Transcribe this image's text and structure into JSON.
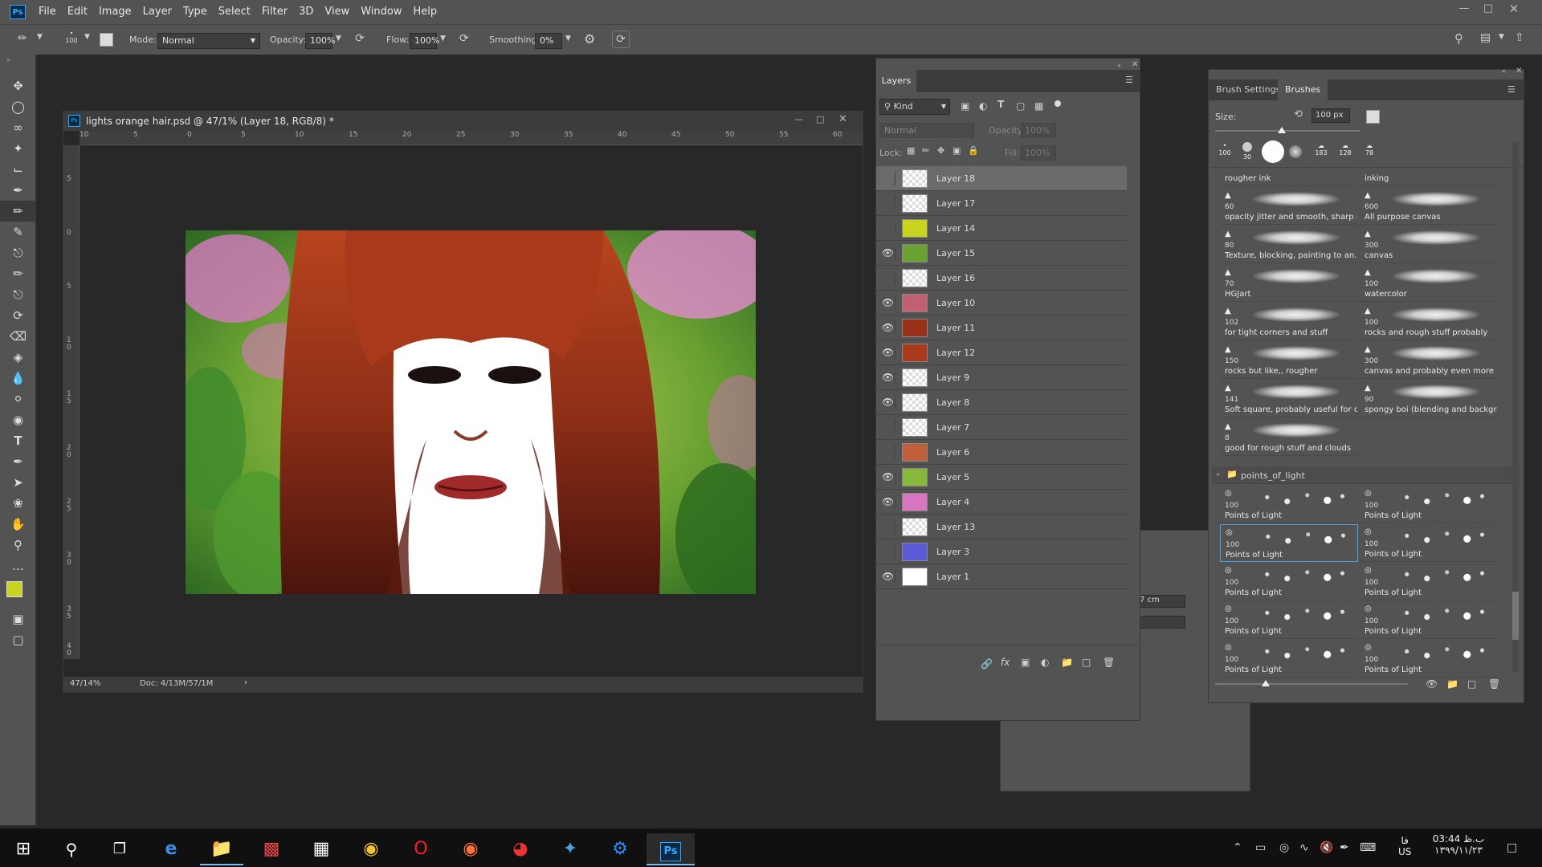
{
  "app": {
    "logo": "Ps"
  },
  "menu": [
    "File",
    "Edit",
    "Image",
    "Layer",
    "Type",
    "Select",
    "Filter",
    "3D",
    "View",
    "Window",
    "Help"
  ],
  "options": {
    "brush_size": "100",
    "mode_label": "Mode:",
    "mode_value": "Normal",
    "opacity_label": "Opacity:",
    "opacity_value": "100%",
    "flow_label": "Flow:",
    "flow_value": "100%",
    "smoothing_label": "Smoothing:",
    "smoothing_value": "0%"
  },
  "document": {
    "title": "lights orange hair.psd @ 47/1% (Layer 18, RGB/8) *",
    "zoom": "47/14%",
    "doc_info": "Doc: 4/13M/57/1M",
    "ruler_h": [
      "10",
      "5",
      "0",
      "5",
      "10",
      "15",
      "20",
      "25",
      "30",
      "35",
      "40",
      "45",
      "50",
      "55",
      "60"
    ],
    "ruler_v": [
      "5",
      "0",
      "5",
      "1\n0",
      "1\n5",
      "2\n0",
      "2\n5",
      "3\n0",
      "3\n5",
      "4\n0"
    ]
  },
  "layers_panel": {
    "tab": "Layers",
    "kind_label": "Kind",
    "blend_mode": "Normal",
    "opacity_label": "Opacity:",
    "opacity_value": "100%",
    "lock_label": "Lock:",
    "fill_label": "Fill:",
    "fill_value": "100%",
    "layers": [
      {
        "name": "Layer 18",
        "visible": false,
        "selected": true
      },
      {
        "name": "Layer 17",
        "visible": false
      },
      {
        "name": "Layer 14",
        "visible": false
      },
      {
        "name": "Layer 15",
        "visible": true
      },
      {
        "name": "Layer 16",
        "visible": false
      },
      {
        "name": "Layer 10",
        "visible": true
      },
      {
        "name": "Layer 11",
        "visible": true
      },
      {
        "name": "Layer 12",
        "visible": true
      },
      {
        "name": "Layer 9",
        "visible": true
      },
      {
        "name": "Layer 8",
        "visible": true
      },
      {
        "name": "Layer 7",
        "visible": false
      },
      {
        "name": "Layer 6",
        "visible": false
      },
      {
        "name": "Layer 5",
        "visible": true
      },
      {
        "name": "Layer 4",
        "visible": true
      },
      {
        "name": "Layer 13",
        "visible": false
      },
      {
        "name": "Layer 3",
        "visible": false
      },
      {
        "name": "Layer 1",
        "visible": true
      }
    ]
  },
  "brushes_panel": {
    "tabs": [
      "Brush Settings",
      "Brushes"
    ],
    "size_label": "Size:",
    "size_value": "100 px",
    "preset_sizes": [
      "100",
      "30",
      "",
      "",
      "183",
      "128",
      "78"
    ],
    "brushes": [
      {
        "num": "",
        "name": "rougher ink"
      },
      {
        "num": "",
        "name": "inking"
      },
      {
        "num": "60",
        "name": "opacity jitter and smooth, sharp i..."
      },
      {
        "num": "600",
        "name": "All purpose canvas"
      },
      {
        "num": "80",
        "name": "Texture, blocking, painting to an..."
      },
      {
        "num": "300",
        "name": "canvas"
      },
      {
        "num": "70",
        "name": "HGJart"
      },
      {
        "num": "100",
        "name": "watercolor"
      },
      {
        "num": "102",
        "name": "for tight corners and stuff"
      },
      {
        "num": "100",
        "name": "rocks and rough stuff probably"
      },
      {
        "num": "150",
        "name": "rocks but like,, rougher"
      },
      {
        "num": "300",
        "name": "canvas and probably even more r..."
      },
      {
        "num": "141",
        "name": "Soft square, probably useful for c..."
      },
      {
        "num": "90",
        "name": "spongy boi (blending and backgr..."
      },
      {
        "num": "8",
        "name": "good for rough stuff and clouds"
      }
    ],
    "group_name": "points_of_light",
    "pol_num": "100",
    "pol_name": "Points of Light",
    "pol_count": 10,
    "partial_field": "7 cm"
  },
  "taskbar": {
    "time": "03:44 ب.ظ",
    "date": "۱۳۹۹/۱۱/۲۳",
    "lang": "فا",
    "lang2": "US",
    "apps": [
      "windows-start",
      "search",
      "task-view",
      "edge",
      "file-explorer",
      "app-red",
      "calculator",
      "chrome",
      "opera",
      "firefox",
      "app-circle",
      "app-bird",
      "app-blue",
      "photoshop"
    ]
  }
}
